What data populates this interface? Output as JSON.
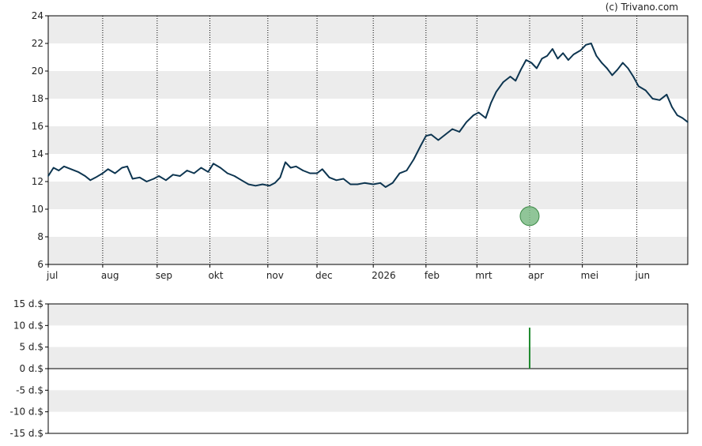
{
  "credit": "(c) Trivano.com",
  "colors": {
    "line": "#0d3550",
    "band": "#ececec",
    "grid": "#000000",
    "marker_fill": "#7dbb86",
    "marker_stroke": "#3c8a47",
    "dividend_bar": "#1f8a2e"
  },
  "chart_data": [
    {
      "type": "line",
      "ylim": [
        6,
        24
      ],
      "y_ticks": [
        "6",
        "8",
        "10",
        "12",
        "14",
        "16",
        "18",
        "20",
        "22",
        "24"
      ],
      "x_range": [
        "2025-07-01",
        "2026-06-30"
      ],
      "x_ticks": [
        {
          "label": "jul",
          "date": "2025-07-01"
        },
        {
          "label": "aug",
          "date": "2025-08-01"
        },
        {
          "label": "sep",
          "date": "2025-09-01"
        },
        {
          "label": "okt",
          "date": "2025-10-01"
        },
        {
          "label": "nov",
          "date": "2025-11-03"
        },
        {
          "label": "dec",
          "date": "2025-12-01"
        },
        {
          "label": "2026",
          "date": "2026-01-02"
        },
        {
          "label": "feb",
          "date": "2026-02-01"
        },
        {
          "label": "mrt",
          "date": "2026-03-02"
        },
        {
          "label": "apr",
          "date": "2026-04-01"
        },
        {
          "label": "mei",
          "date": "2026-05-01"
        },
        {
          "label": "jun",
          "date": "2026-06-01"
        }
      ],
      "grid": true,
      "series": [
        {
          "points": [
            [
              "2025-07-01",
              12.4
            ],
            [
              "2025-07-04",
              13.0
            ],
            [
              "2025-07-07",
              12.8
            ],
            [
              "2025-07-10",
              13.1
            ],
            [
              "2025-07-14",
              12.9
            ],
            [
              "2025-07-18",
              12.7
            ],
            [
              "2025-07-22",
              12.4
            ],
            [
              "2025-07-25",
              12.1
            ],
            [
              "2025-07-28",
              12.3
            ],
            [
              "2025-08-01",
              12.6
            ],
            [
              "2025-08-04",
              12.9
            ],
            [
              "2025-08-08",
              12.6
            ],
            [
              "2025-08-12",
              13.0
            ],
            [
              "2025-08-15",
              13.1
            ],
            [
              "2025-08-18",
              12.2
            ],
            [
              "2025-08-22",
              12.3
            ],
            [
              "2025-08-26",
              12.0
            ],
            [
              "2025-08-30",
              12.2
            ],
            [
              "2025-09-02",
              12.4
            ],
            [
              "2025-09-06",
              12.1
            ],
            [
              "2025-09-10",
              12.5
            ],
            [
              "2025-09-14",
              12.4
            ],
            [
              "2025-09-18",
              12.8
            ],
            [
              "2025-09-22",
              12.6
            ],
            [
              "2025-09-26",
              13.0
            ],
            [
              "2025-09-30",
              12.7
            ],
            [
              "2025-10-03",
              13.3
            ],
            [
              "2025-10-07",
              13.0
            ],
            [
              "2025-10-11",
              12.6
            ],
            [
              "2025-10-15",
              12.4
            ],
            [
              "2025-10-19",
              12.1
            ],
            [
              "2025-10-23",
              11.8
            ],
            [
              "2025-10-27",
              11.7
            ],
            [
              "2025-10-31",
              11.8
            ],
            [
              "2025-11-04",
              11.7
            ],
            [
              "2025-11-07",
              11.9
            ],
            [
              "2025-11-10",
              12.3
            ],
            [
              "2025-11-13",
              13.4
            ],
            [
              "2025-11-16",
              13.0
            ],
            [
              "2025-11-19",
              13.1
            ],
            [
              "2025-11-23",
              12.8
            ],
            [
              "2025-11-27",
              12.6
            ],
            [
              "2025-12-01",
              12.6
            ],
            [
              "2025-12-04",
              12.9
            ],
            [
              "2025-12-08",
              12.3
            ],
            [
              "2025-12-12",
              12.1
            ],
            [
              "2025-12-16",
              12.2
            ],
            [
              "2025-12-20",
              11.8
            ],
            [
              "2025-12-24",
              11.8
            ],
            [
              "2025-12-28",
              11.9
            ],
            [
              "2026-01-02",
              11.8
            ],
            [
              "2026-01-06",
              11.9
            ],
            [
              "2026-01-09",
              11.6
            ],
            [
              "2026-01-13",
              11.9
            ],
            [
              "2026-01-17",
              12.6
            ],
            [
              "2026-01-21",
              12.8
            ],
            [
              "2026-01-25",
              13.6
            ],
            [
              "2026-01-29",
              14.6
            ],
            [
              "2026-02-01",
              15.3
            ],
            [
              "2026-02-04",
              15.4
            ],
            [
              "2026-02-08",
              15.0
            ],
            [
              "2026-02-12",
              15.4
            ],
            [
              "2026-02-16",
              15.8
            ],
            [
              "2026-02-20",
              15.6
            ],
            [
              "2026-02-24",
              16.3
            ],
            [
              "2026-02-28",
              16.8
            ],
            [
              "2026-03-03",
              17.0
            ],
            [
              "2026-03-07",
              16.6
            ],
            [
              "2026-03-10",
              17.7
            ],
            [
              "2026-03-13",
              18.5
            ],
            [
              "2026-03-17",
              19.2
            ],
            [
              "2026-03-21",
              19.6
            ],
            [
              "2026-03-24",
              19.3
            ],
            [
              "2026-03-27",
              20.1
            ],
            [
              "2026-03-30",
              20.8
            ],
            [
              "2026-04-02",
              20.6
            ],
            [
              "2026-04-05",
              20.2
            ],
            [
              "2026-04-08",
              20.9
            ],
            [
              "2026-04-11",
              21.1
            ],
            [
              "2026-04-14",
              21.6
            ],
            [
              "2026-04-17",
              20.9
            ],
            [
              "2026-04-20",
              21.3
            ],
            [
              "2026-04-23",
              20.8
            ],
            [
              "2026-04-26",
              21.2
            ],
            [
              "2026-04-30",
              21.5
            ],
            [
              "2026-05-03",
              21.9
            ],
            [
              "2026-05-06",
              22.0
            ],
            [
              "2026-05-09",
              21.1
            ],
            [
              "2026-05-12",
              20.6
            ],
            [
              "2026-05-15",
              20.2
            ],
            [
              "2026-05-18",
              19.7
            ],
            [
              "2026-05-21",
              20.1
            ],
            [
              "2026-05-24",
              20.6
            ],
            [
              "2026-05-27",
              20.2
            ],
            [
              "2026-05-30",
              19.6
            ],
            [
              "2026-06-02",
              18.9
            ],
            [
              "2026-06-06",
              18.6
            ],
            [
              "2026-06-10",
              18.0
            ],
            [
              "2026-06-14",
              17.9
            ],
            [
              "2026-06-18",
              18.3
            ],
            [
              "2026-06-21",
              17.4
            ],
            [
              "2026-06-24",
              16.8
            ],
            [
              "2026-06-27",
              16.6
            ],
            [
              "2026-06-30",
              16.3
            ]
          ]
        }
      ],
      "marker": {
        "date": "2026-04-01",
        "y": 9.5
      }
    },
    {
      "type": "bar",
      "ylim": [
        -15,
        15
      ],
      "y_ticks": [
        "15 d.$",
        "10 d.$",
        "5 d.$",
        "0 d.$",
        "-5 d.$",
        "-10 d.$",
        "-15 d.$"
      ],
      "grid": true,
      "bars": [
        {
          "date": "2026-04-01",
          "value": 9.5
        }
      ]
    }
  ]
}
